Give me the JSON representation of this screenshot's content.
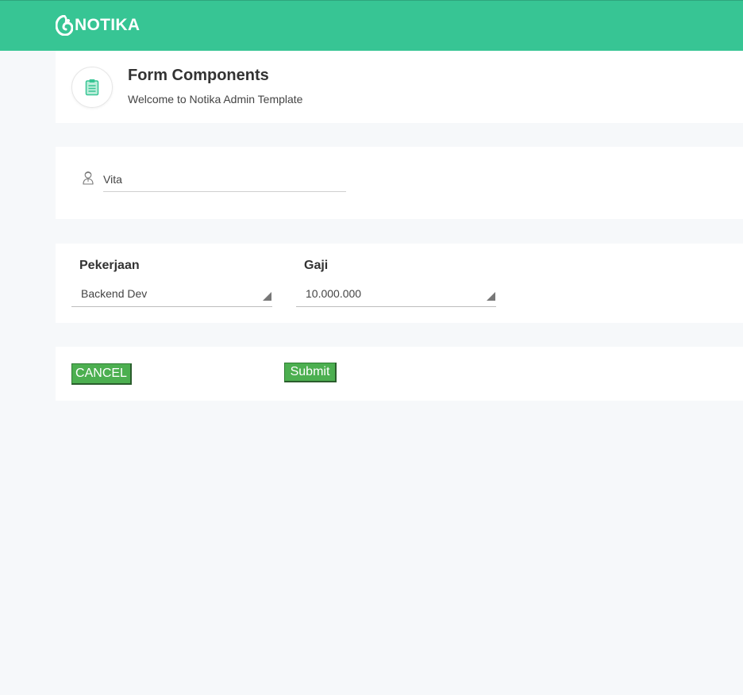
{
  "app": {
    "brand": "NOTIKA",
    "logo_icon": "notika-swirl-icon",
    "accent_color": "#37c594"
  },
  "header": {
    "icon": "clipboard-icon",
    "title": "Form Components",
    "subtitle": "Welcome to Notika Admin Template"
  },
  "form": {
    "name_field": {
      "icon": "user-icon",
      "value": "Vita"
    },
    "job": {
      "label": "Pekerjaan",
      "selected": "Backend Dev"
    },
    "salary": {
      "label": "Gaji",
      "selected": "10.000.000"
    },
    "buttons": {
      "cancel_label": "CANCEL",
      "submit_label": "Submit",
      "color": "#4caf50"
    }
  }
}
